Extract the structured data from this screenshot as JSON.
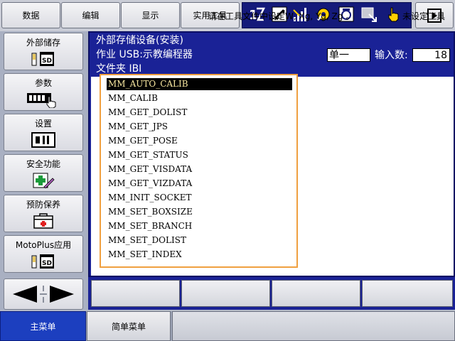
{
  "top_menu": {
    "data_label": "数据",
    "edit_label": "编辑",
    "display_label": "显示",
    "utility_label": "实用工具"
  },
  "toolbar_icons": [
    "axis-switch-icon",
    "manual-speed-icon",
    "signal-level-icon",
    "robot-gear-icon",
    "servo-icon",
    "monitor-arrow-icon",
    "hand-pointer-icon"
  ],
  "sidebar": {
    "items": [
      {
        "label": "外部储存",
        "icon": "sd-card-icon"
      },
      {
        "label": "参数",
        "icon": "parameter-hand-icon"
      },
      {
        "label": "设置",
        "icon": "settings-panel-icon"
      },
      {
        "label": "安全功能",
        "icon": "safety-cross-icon"
      },
      {
        "label": "预防保养",
        "icon": "first-aid-icon"
      },
      {
        "label": "MotoPlus应用",
        "icon": "sd-card-icon"
      }
    ]
  },
  "header": {
    "title": "外部存储设备(安装)",
    "job_line": "作业 USB:示教编程器",
    "folder_line": "文件夹 IBI",
    "mode_value": "单一",
    "input_count_label": "输入数:",
    "input_count_value": "18"
  },
  "file_list": {
    "items": [
      "MM_AUTO_CALIB",
      "MM_CALIB",
      "MM_GET_DOLIST",
      "MM_GET_JPS",
      "MM_GET_POSE",
      "MM_GET_STATUS",
      "MM_GET_VISDATA",
      "MM_GET_VIZDATA",
      "MM_INIT_SOCKET",
      "MM_SET_BOXSIZE",
      "MM_SET_BRANCH",
      "MM_SET_DOLIST",
      "MM_SET_INDEX"
    ],
    "selected_index": 0
  },
  "status_bar": {
    "main_menu_label": "主菜单",
    "simple_menu_label": "简单菜单",
    "message": "请在工具文件中设定W, Xg, Yg, Zg 。",
    "right_message": "未设定工具"
  },
  "colors": {
    "panel_blue": "#1a2296",
    "toolbar_blue": "#141a7a",
    "highlight_orange": "#f0a040",
    "main_menu_blue": "#1c3fbf"
  }
}
